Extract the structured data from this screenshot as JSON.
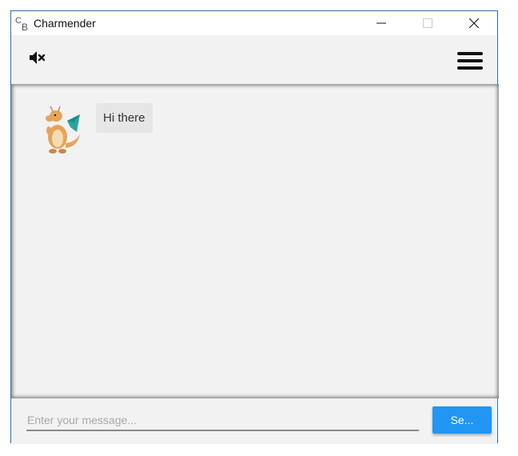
{
  "window": {
    "title": "Charmender",
    "logo_text": "CB",
    "logo_c": "C",
    "logo_b": "B",
    "controls": [
      "minimize-icon",
      "maximize-icon",
      "close-icon"
    ]
  },
  "toolbar": {
    "mute_icon": "volume-muted-icon",
    "menu_icon": "hamburger-menu-icon"
  },
  "chat": {
    "messages": [
      {
        "sender": "bot",
        "avatar": "dragon-avatar",
        "text": "Hi there"
      }
    ]
  },
  "composer": {
    "placeholder": "Enter your message...",
    "value": "",
    "send_label": "Se..."
  },
  "colors": {
    "accent": "#2196f3",
    "window_border": "#2f6fb6",
    "background": "#f2f2f2",
    "bubble": "#e6e6e6"
  }
}
